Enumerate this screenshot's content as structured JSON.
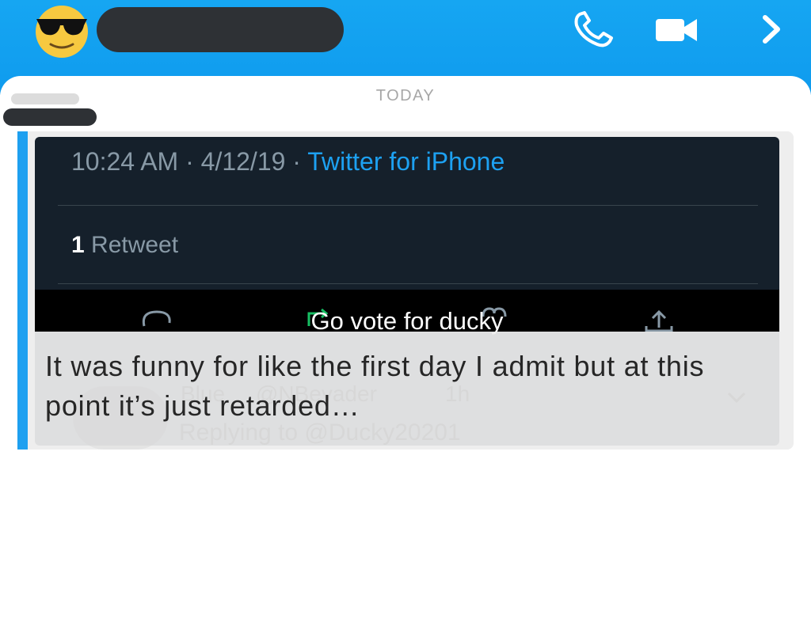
{
  "header": {
    "avatar_icon": "sunglasses-emoji-icon",
    "call_icon": "phone-icon",
    "video_icon": "video-camera-icon",
    "next_icon": "chevron-right-icon",
    "background_color": "#16a6f2"
  },
  "chat": {
    "day_label": "TODAY",
    "accent_color": "#1ea0f0"
  },
  "tweet_screenshot": {
    "time": "10:24 AM",
    "separator_1": " · ",
    "date": "4/12/19",
    "separator_2": " · ",
    "source": "Twitter for iPhone",
    "retweet_count": "1",
    "retweet_label": " Retweet",
    "caption": "Go vote for ducky",
    "ghost_name": "Blue",
    "ghost_handle": "@NBevader",
    "ghost_time": "1h",
    "ghost_reply": "Replying to @Ducky20201",
    "action_icons": [
      "reply-icon",
      "retweet-icon",
      "like-icon",
      "share-icon"
    ],
    "background_color": "#15202b"
  },
  "message": {
    "text": "It was funny for like the first day I admit but at this point it’s just retarded…"
  }
}
